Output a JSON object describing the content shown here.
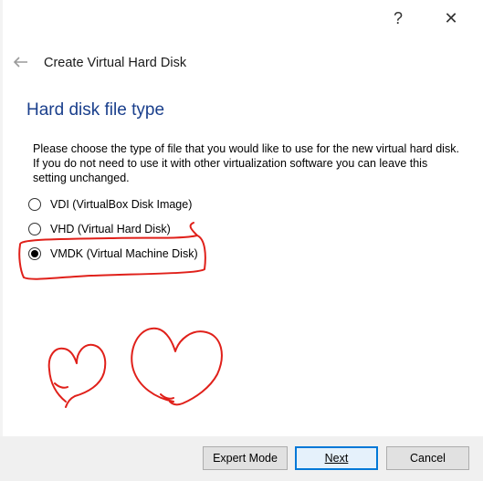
{
  "titlebar": {
    "help_label": "?",
    "close_label": "✕"
  },
  "header": {
    "wizard_title": "Create Virtual Hard Disk"
  },
  "page": {
    "title": "Hard disk file type",
    "description": "Please choose the type of file that you would like to use for the new virtual hard disk. If you do not need to use it with other virtualization software you can leave this setting unchanged."
  },
  "options": [
    {
      "label": "VDI (VirtualBox Disk Image)",
      "checked": false
    },
    {
      "label": "VHD (Virtual Hard Disk)",
      "checked": false
    },
    {
      "label": "VMDK (Virtual Machine Disk)",
      "checked": true
    }
  ],
  "footer": {
    "expert_label": "Expert Mode",
    "next_label": "Next",
    "cancel_label": "Cancel"
  },
  "colors": {
    "title_blue": "#1a3f8c",
    "annotation_red": "#e0201a",
    "focus_blue": "#0078d7"
  }
}
